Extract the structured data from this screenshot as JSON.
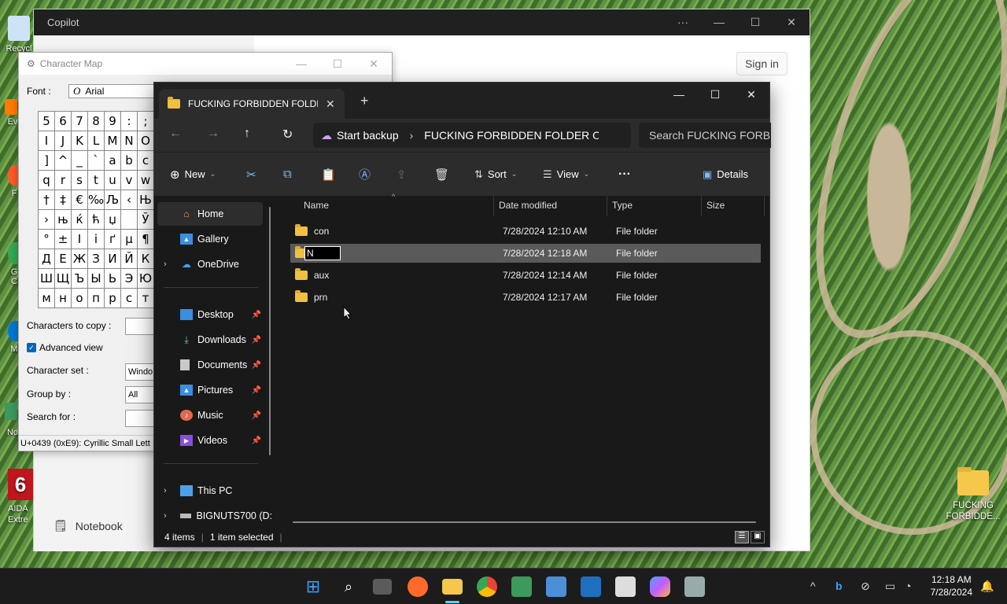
{
  "desktop": {
    "icons": [
      {
        "label": "Recycl",
        "name": "recycle-bin"
      },
      {
        "label": "Ev",
        "name": "everything"
      },
      {
        "label": "F",
        "name": "firefox"
      },
      {
        "label": "G C",
        "name": "chrome"
      },
      {
        "label": "M",
        "name": "microsoft"
      },
      {
        "label": "No",
        "name": "notepad"
      },
      {
        "label": "AIDA Extre",
        "name": "aida64"
      }
    ],
    "folder_label": "FUCKING FORBIDDE..."
  },
  "copilot": {
    "title": "Copilot",
    "controls": [
      "···",
      "—",
      "☐",
      "✕"
    ],
    "sign_in": "Sign in",
    "notebook": "Notebook"
  },
  "charmap": {
    "title": "Character Map",
    "font_label": "Font :",
    "font_value": "Arial",
    "chars": [
      "5",
      "6",
      "7",
      "8",
      "9",
      ":",
      ";",
      "I",
      "J",
      "K",
      "L",
      "M",
      "N",
      "O",
      "]",
      "^",
      "_",
      "`",
      "a",
      "b",
      "c",
      "q",
      "r",
      "s",
      "t",
      "u",
      "v",
      "w",
      "†",
      "‡",
      "€",
      "‰",
      "Љ",
      "‹",
      "Њ",
      "›",
      "њ",
      "ќ",
      "ћ",
      "џ",
      " ",
      "Ў",
      "°",
      "±",
      "І",
      "і",
      "ґ",
      "µ",
      "¶",
      "Д",
      "Е",
      "Ж",
      "З",
      "И",
      "Й",
      "К",
      "Ш",
      "Щ",
      "Ъ",
      "Ы",
      "Ь",
      "Э",
      "Ю",
      "м",
      "н",
      "о",
      "п",
      "р",
      "с",
      "т"
    ],
    "copy_label": "Characters to copy :",
    "advanced_label": "Advanced view",
    "charset_label": "Character set :",
    "charset_value": "Windo",
    "groupby_label": "Group by :",
    "groupby_value": "All",
    "search_label": "Search for :",
    "status": "U+0439 (0xE9): Cyrillic Small Lett"
  },
  "explorer": {
    "tab_title": "FUCKING FORBIDDEN FOLDER ON WINDOWS",
    "address_backup": "Start backup",
    "address_path": "FUCKING FORBIDDEN FOLDER ON WINDOWS",
    "search_placeholder": "Search FUCKING FORBIDDEN FOLDER ON WINDOWS",
    "commands": {
      "new": "New",
      "sort": "Sort",
      "view": "View",
      "more": "···",
      "details": "Details"
    },
    "nav": {
      "home": "Home",
      "gallery": "Gallery",
      "onedrive": "OneDrive",
      "desktop": "Desktop",
      "downloads": "Downloads",
      "documents": "Documents",
      "pictures": "Pictures",
      "music": "Music",
      "videos": "Videos",
      "thispc": "This PC",
      "drive": "BIGNUTS700 (D:"
    },
    "columns": {
      "name": "Name",
      "date": "Date modified",
      "type": "Type",
      "size": "Size"
    },
    "files": [
      {
        "name": "con",
        "date": "7/28/2024 12:10 AM",
        "type": "File folder"
      },
      {
        "name": "N",
        "date": "7/28/2024 12:18 AM",
        "type": "File folder"
      },
      {
        "name": "aux",
        "date": "7/28/2024 12:14 AM",
        "type": "File folder"
      },
      {
        "name": "prn",
        "date": "7/28/2024 12:17 AM",
        "type": "File folder"
      }
    ],
    "status_count": "4 items",
    "status_selected": "1 item selected"
  },
  "taskbar": {
    "time": "12:18 AM",
    "date": "7/28/2024"
  },
  "colors": {
    "accent": "#0067c0",
    "folder": "#f0c040",
    "explorer_bg": "#191919",
    "selection": "#5a5a5a"
  }
}
